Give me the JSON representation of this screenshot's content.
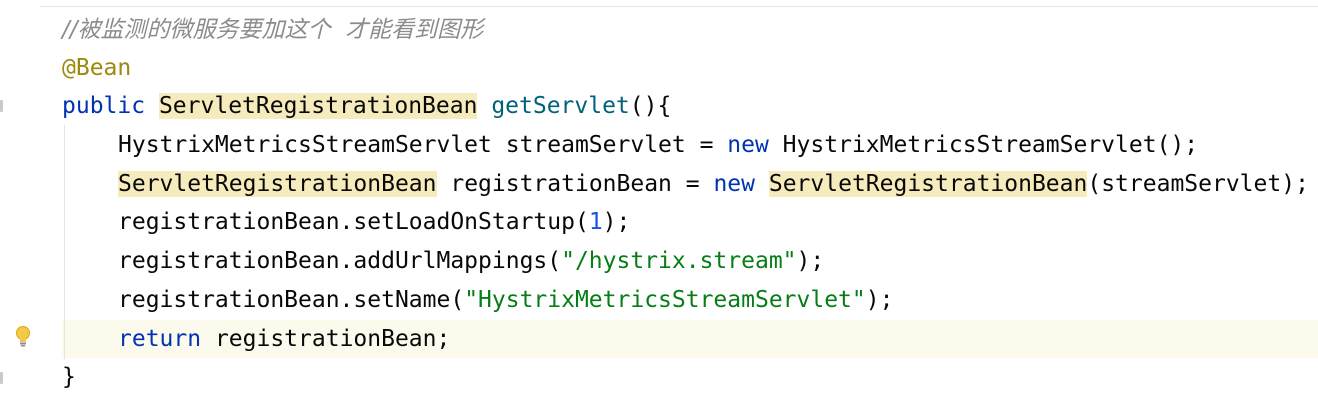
{
  "editor": {
    "lines": [
      {
        "comment": "//被监测的微服务要加这个  才能看到图形"
      },
      {
        "annotation": "@Bean"
      },
      {
        "kw_public": "public",
        "type": "ServletRegistrationBean",
        "method": "getServlet",
        "tail": "(){"
      },
      {
        "type1": "HystrixMetricsStreamServlet",
        "var": " streamServlet = ",
        "kw_new": "new",
        "type2": " HystrixMetricsStreamServlet",
        "tail": "();"
      },
      {
        "type1": "ServletRegistrationBean",
        "var": " registrationBean = ",
        "kw_new": "new",
        "type2": "ServletRegistrationBean",
        "tail": "(streamServlet);"
      },
      {
        "prefix": "registrationBean.setLoadOnStartup(",
        "num": "1",
        "tail": ");"
      },
      {
        "prefix": "registrationBean.addUrlMappings(",
        "str": "\"/hystrix.stream\"",
        "tail": ");"
      },
      {
        "prefix": "registrationBean.setName(",
        "str": "\"HystrixMetricsStreamServlet\"",
        "tail": ");"
      },
      {
        "kw_return": "return",
        "tail": " registrationBean;"
      },
      {
        "brace": "}"
      }
    ],
    "colors": {
      "keyword": "#0033b3",
      "method": "#00627a",
      "string": "#067d17",
      "number": "#1750eb",
      "annotation": "#9e880d",
      "comment": "#8c8c8c",
      "highlight": "#f6ebbc",
      "current_line": "#fcfaed"
    },
    "icons": {
      "intention": "lightbulb-icon"
    }
  }
}
